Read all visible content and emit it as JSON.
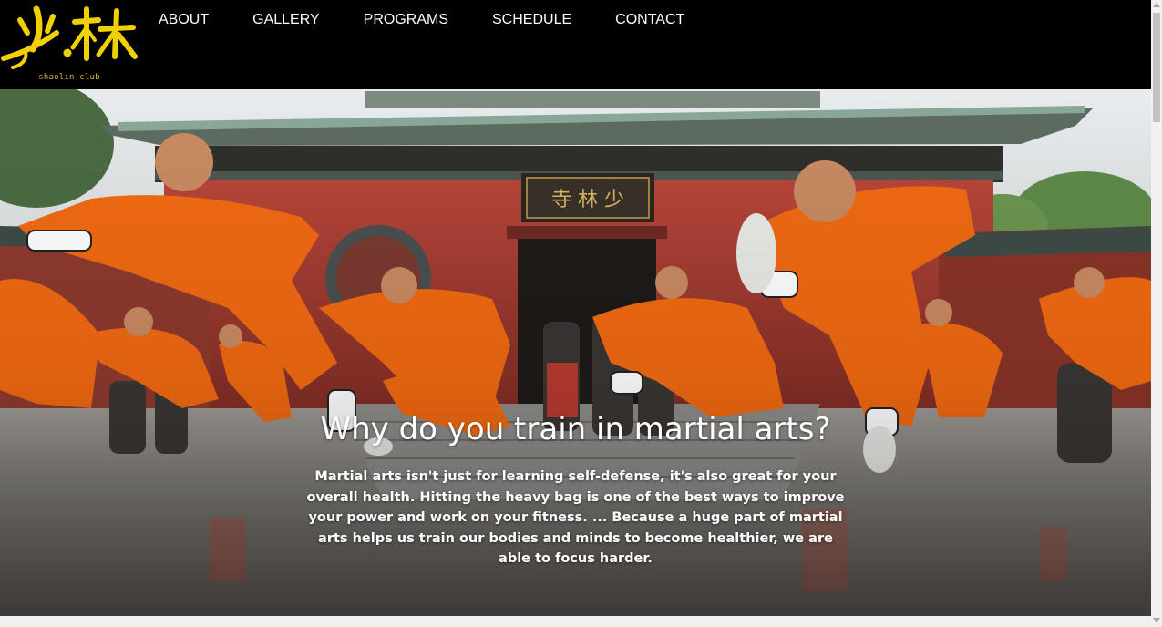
{
  "header": {
    "logo": {
      "glyphs": "少林",
      "subtitle": "shaolin-club",
      "color": "#f0d000"
    },
    "nav": [
      {
        "label": "ABOUT"
      },
      {
        "label": "GALLERY"
      },
      {
        "label": "PROGRAMS"
      },
      {
        "label": "SCHEDULE"
      },
      {
        "label": "CONTACT"
      }
    ],
    "background": "#000000"
  },
  "hero": {
    "title": "Why do you train in martial arts?",
    "text": "Martial arts isn't just for learning self-defense, it's also great for your overall health. Hitting the heavy bag is one of the best ways to improve your power and work on your fitness. ... Because a huge part of martial arts helps us train our bodies and minds to become healthier, we are able to focus harder.",
    "image": {
      "plaque_text": "寺林少",
      "robe_color": "#f26a12"
    }
  }
}
